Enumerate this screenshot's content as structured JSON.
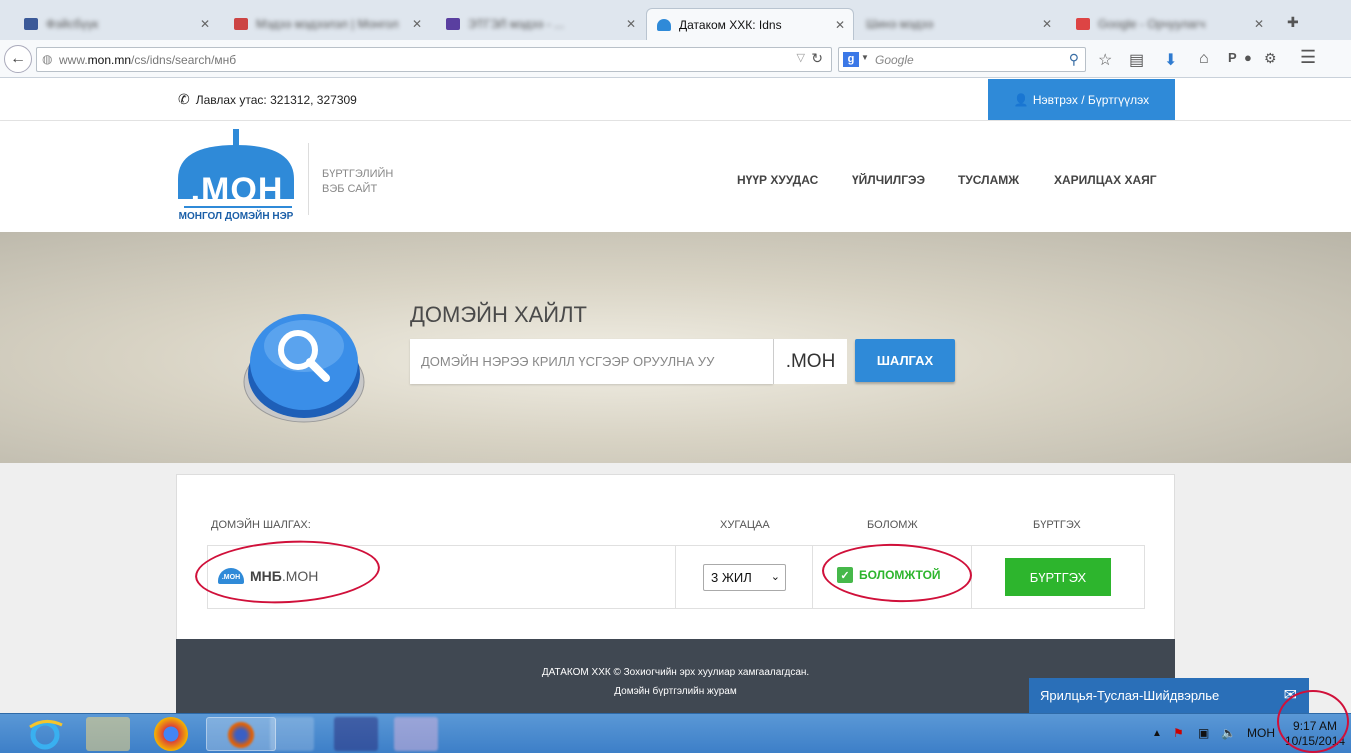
{
  "browser": {
    "tabs": [
      {
        "title": "Фэйсбүүк",
        "blurred": true
      },
      {
        "title": "Мэдээ мэдээлэл | Монгол",
        "blurred": true
      },
      {
        "title": "ЭТГЭЛ мэдээ - ...",
        "blurred": true
      },
      {
        "title": "Датаком ХХК: Idns",
        "blurred": false
      },
      {
        "title": "Шинэ мэдээ",
        "blurred": true
      },
      {
        "title": "Google - Орчуулагч",
        "blurred": true
      }
    ],
    "url_prefix": "www.",
    "url_domain": "mon.mn",
    "url_path": "/cs/idns/search/мнб",
    "search_engine": "Google"
  },
  "site": {
    "phone": "Лавлах утас: 321312, 327309",
    "login": "Нэвтрэх / Бүртгүүлэх",
    "logo_top": ".МОН",
    "logo_bottom": "МОНГОЛ ДОМЭЙН НЭР",
    "logo_tagline_1": "БҮРТГЭЛИЙН",
    "logo_tagline_2": "ВЭБ САЙТ",
    "nav": [
      "НҮҮР ХУУДАС",
      "ҮЙЛЧИЛГЭЭ",
      "ТУСЛАМЖ",
      "ХАРИЛЦАХ ХАЯГ"
    ]
  },
  "hero": {
    "title": "ДОМЭЙН ХАЙЛТ",
    "placeholder": "ДОМЭЙН НЭРЭЭ КРИЛЛ ҮСГЭЭР ОРУУЛНА УУ",
    "tld": ".МОН",
    "button": "ШАЛГАХ"
  },
  "results": {
    "headers": {
      "domain": "ДОМЭЙН ШАЛГАХ:",
      "period": "ХУГАЦАА",
      "status": "БОЛОМЖ",
      "register": "БҮРТГЭХ"
    },
    "row": {
      "name": "МНБ",
      "tld": ".МОН",
      "period": "3 ЖИЛ",
      "status": "БОЛОМЖТОЙ",
      "button": "БҮРТГЭХ"
    }
  },
  "footer": {
    "copyright": "ДАТАКОМ ХХК © Зохиогчийн эрх хуулиар хамгаалагдсан.",
    "terms": "Домэйн бүртгэлийн журам"
  },
  "chat": {
    "label": "Ярилцья-Туслая-Шийдвэрлье"
  },
  "taskbar": {
    "lang": "МОН",
    "time": "9:17 AM",
    "date": "10/15/2014"
  },
  "colors": {
    "primary": "#2f8ad8",
    "success": "#2db52d",
    "footer": "#404852",
    "annotation": "#d0103a"
  }
}
